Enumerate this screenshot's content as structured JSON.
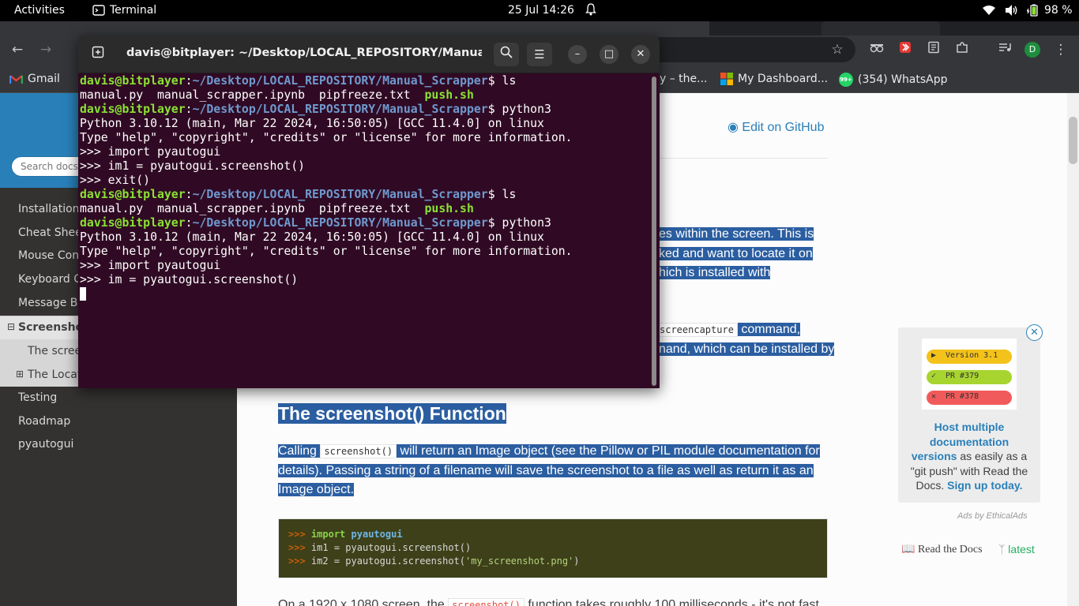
{
  "topbar": {
    "activities": "Activities",
    "app_name": "Terminal",
    "datetime": "25 Jul  14:26",
    "battery": "98 %"
  },
  "bookmarks": {
    "gmail": "Gmail",
    "partial": "y – the...",
    "dashboard": "My Dashboard...",
    "whatsapp": "(354) WhatsApp",
    "whatsapp_badge": "99+"
  },
  "profile_initial": "D",
  "terminal": {
    "title": "davis@bitplayer: ~/Desktop/LOCAL_REPOSITORY/Manual_Sc...",
    "user_host": "davis@bitplayer",
    "path": "~/Desktop/LOCAL_REPOSITORY/Manual_Scrapper",
    "files_a": "manual.py  manual_scrapper.ipynb  pipfreeze.txt  ",
    "files_b": "push.sh",
    "cmd_ls": "$ ls",
    "cmd_python": "$ python3",
    "py_version": "Python 3.10.12 (main, Mar 22 2024, 16:50:05) [GCC 11.4.0] on linux",
    "py_help": "Type \"help\", \"copyright\", \"credits\" or \"license\" for more information.",
    "l_import": ">>> import pyautogui",
    "l_im1": ">>> im1 = pyautogui.screenshot()",
    "l_exit": ">>> exit()",
    "l_im": ">>> im = pyautogui.screenshot()"
  },
  "sidebar": {
    "search_placeholder": "Search docs",
    "items": [
      "Installation",
      "Cheat Sheet",
      "Mouse Control Functions",
      "Keyboard Control Functions",
      "Message Box Functions"
    ],
    "current": "Screenshot Functions",
    "sub1": "The screenshot() Function",
    "sub2": "The Locate Functions",
    "items2": [
      "Testing",
      "Roadmap",
      "pyautogui"
    ]
  },
  "content": {
    "edit_github": "Edit on GitHub",
    "frag1": "es within the screen. This is",
    "frag2": "ked and want to locate it on",
    "frag3": "hich is installed with",
    "frag4_code": "screencapture",
    "frag4": " command,",
    "frag5": "nand, which can be installed by",
    "heading": "The screenshot() Function",
    "p1_a": "Calling ",
    "p1_code": "screenshot()",
    "p1_b": " will return an Image object (see the Pillow or PIL module documentation for",
    "p1_line2": "details). Passing a string of a filename will save the screenshot to a file as well as return it as an",
    "p1_line3": "Image object.",
    "code_prompt": ">>>",
    "code_import_kw": "import",
    "code_import_mod": "pyautogui",
    "code_l2": "im1 = pyautogui.screenshot()",
    "code_l3_a": "im2 = pyautogui.screenshot(",
    "code_l3_str": "'my_screenshot.png'",
    "code_l3_b": ")",
    "bottom_a": "On a 1920 x 1080 screen, the ",
    "bottom_code": "screenshot()",
    "bottom_b": " function takes roughly 100 milliseconds - it's not fast"
  },
  "ad": {
    "pill1": "Version 3.1",
    "pill2": "PR #379",
    "pill3": "PR #378",
    "link": "Host multiple documentation versions",
    "text": " as easily as a \"git push\" with Read the Docs. ",
    "cta": "Sign up today.",
    "by": "Ads by EthicalAds"
  },
  "rtd": {
    "brand": "Read the Docs",
    "version": "latest"
  }
}
